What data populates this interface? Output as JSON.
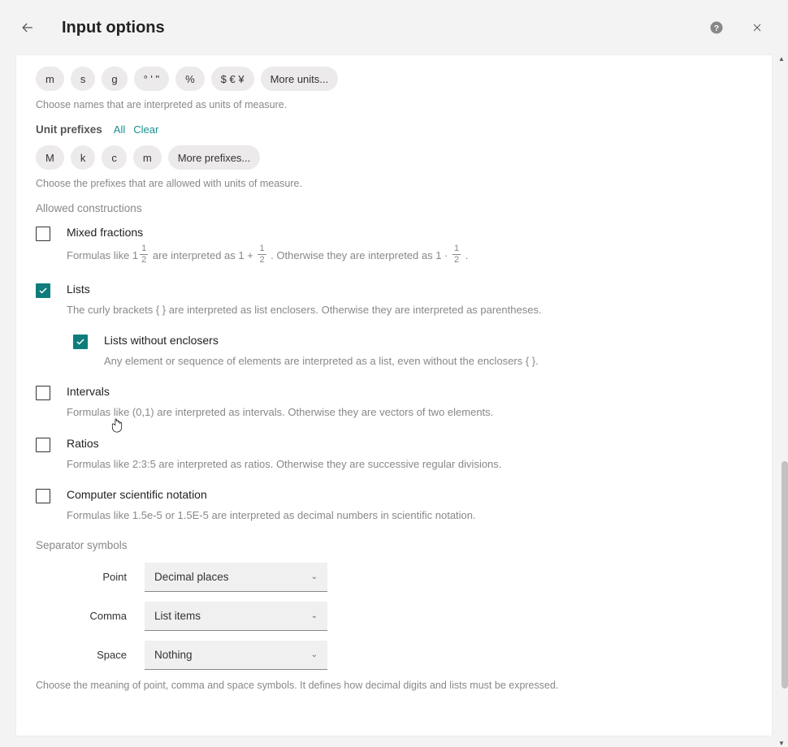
{
  "title": "Input options",
  "units": {
    "chips": [
      "m",
      "s",
      "g",
      "° ' \"",
      "%",
      "$ € ¥",
      "More units..."
    ],
    "helper": "Choose names that are interpreted as units of measure."
  },
  "prefixes": {
    "label": "Unit prefixes",
    "link_all": "All",
    "link_clear": "Clear",
    "chips": [
      "M",
      "k",
      "c",
      "m",
      "More prefixes..."
    ],
    "helper": "Choose the prefixes that are allowed with units of measure."
  },
  "allowed_label": "Allowed constructions",
  "mixed": {
    "label": "Mixed fractions",
    "checked": false,
    "desc_pre": "Formulas like 1",
    "desc_mid1": " are interpreted as  1 + ",
    "desc_mid2": " . Otherwise they are interpreted as  1 · ",
    "desc_post": " .",
    "frac_num": "1",
    "frac_den": "2"
  },
  "lists": {
    "label": "Lists",
    "checked": true,
    "desc": "The curly brackets { } are interpreted as list enclosers. Otherwise they are interpreted as parentheses."
  },
  "lists_no_encl": {
    "label": "Lists without enclosers",
    "checked": true,
    "desc": "Any element or sequence of elements are interpreted as a list, even without the enclosers { }."
  },
  "intervals": {
    "label": "Intervals",
    "checked": false,
    "desc": "Formulas like (0,1) are interpreted as intervals. Otherwise they are vectors of two elements."
  },
  "ratios": {
    "label": "Ratios",
    "checked": false,
    "desc": "Formulas like 2:3:5 are interpreted as ratios. Otherwise they are successive regular divisions."
  },
  "csn": {
    "label": "Computer scientific notation",
    "checked": false,
    "desc": "Formulas like 1.5e-5 or 1.5E-5 are interpreted as decimal numbers in scientific notation."
  },
  "separators": {
    "label": "Separator symbols",
    "rows": [
      {
        "label": "Point",
        "value": "Decimal places"
      },
      {
        "label": "Comma",
        "value": "List items"
      },
      {
        "label": "Space",
        "value": "Nothing"
      }
    ],
    "helper": "Choose the meaning of point, comma and space symbols. It defines how decimal digits and lists must be expressed."
  }
}
